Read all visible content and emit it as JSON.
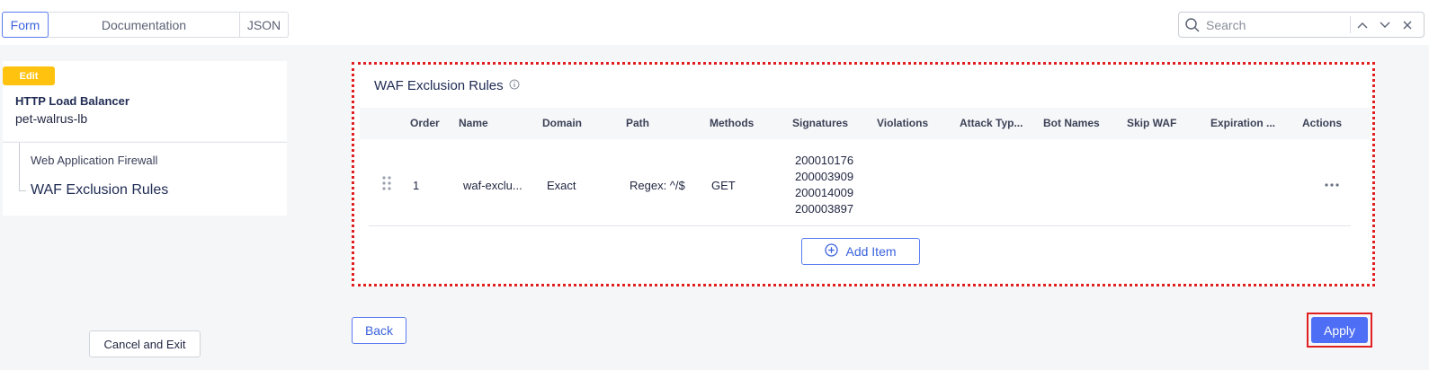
{
  "tabs": [
    {
      "label": "Form",
      "active": true
    },
    {
      "label": "Documentation",
      "active": false
    },
    {
      "label": "JSON",
      "active": false
    }
  ],
  "search": {
    "placeholder": "Search",
    "value": ""
  },
  "sidebar": {
    "badge": "Edit",
    "object_type": "HTTP Load Balancer",
    "object_name": "pet-walrus-lb",
    "nav": [
      {
        "label": "Web Application Firewall"
      },
      {
        "label": "WAF Exclusion Rules"
      }
    ],
    "cancel_label": "Cancel and Exit"
  },
  "section": {
    "title": "WAF Exclusion Rules",
    "columns": [
      "Order",
      "Name",
      "Domain",
      "Path",
      "Methods",
      "Signatures",
      "Violations",
      "Attack Typ...",
      "Bot Names",
      "Skip WAF",
      "Expiration ...",
      "Actions"
    ],
    "rows": [
      {
        "order": "1",
        "name": "waf-exclu...",
        "domain": "Exact",
        "path": "Regex: ^/$",
        "methods": "GET",
        "signatures": [
          "200010176",
          "200003909",
          "200014009",
          "200003897"
        ]
      }
    ],
    "add_label": "Add Item"
  },
  "footer": {
    "back_label": "Back",
    "apply_label": "Apply"
  },
  "colors": {
    "accent": "#4d6ef5",
    "badge": "#ffc20e",
    "highlight": "#e02020"
  }
}
